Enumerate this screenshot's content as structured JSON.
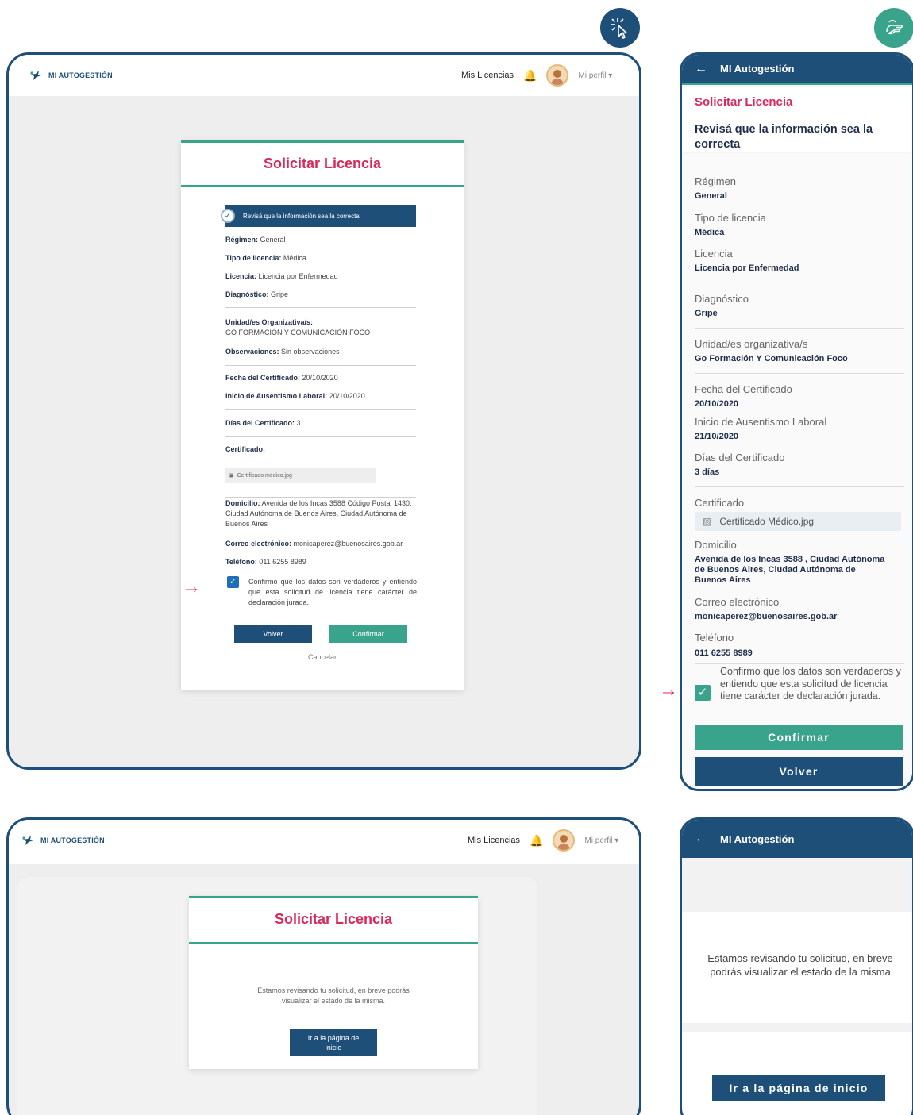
{
  "brand": "MI AUTOGESTIÓN",
  "mobile_app_title": "MI Autogestión",
  "nav": {
    "licencias_a": "Mis Licencias",
    "licencias_b": "Mis Licencias",
    "profile": "Mi perfil"
  },
  "form": {
    "title": "Solicitar Licencia",
    "banner": "Revisá que la información sea la correcta",
    "regimen_label": "Régimen:",
    "regimen_value": "General",
    "tipo_label": "Tipo de licencia:",
    "tipo_value": "Médica",
    "licencia_label": "Licencia:",
    "licencia_value": "Licencia por Enfermedad",
    "diag_label": "Diagnóstico:",
    "diag_value": "Gripe",
    "unidad_label": "Unidad/es Organizativa/s:",
    "unidad_value": "GO FORMACIÓN Y COMUNICACIÓN FOCO",
    "obs_label": "Observaciones:",
    "obs_value": "Sin observaciones",
    "fecha_label": "Fecha del Certificado:",
    "fecha_value": "20/10/2020",
    "inicio_label": "Inicio de Ausentismo Laboral:",
    "inicio_value": "20/10/2020",
    "dias_label": "Días del Certificado:",
    "dias_value": "3",
    "cert_label": "Certificado:",
    "cert_file": "Certificado médico.jpg",
    "dom_label": "Domicilio:",
    "dom_value": "Avenida de los Incas 3588 Código Postal 1430. Ciudad Autónoma de Buenos Aires, Ciudad Autónoma de Buenos Aires",
    "mail_label": "Correo electrónico:",
    "mail_value": "monicaperez@buenosaires.gob.ar",
    "tel_label": "Teléfono:",
    "tel_value": "011 6255 8989",
    "confirm_text": "Confirmo que los datos son verdaderos y entiendo que esta solicitud de licencia tiene carácter de declaración jurada.",
    "volver": "Volver",
    "confirmar": "Confirmar",
    "cancelar": "Cancelar"
  },
  "mobile_form": {
    "title": "Solicitar Licencia",
    "subtitle": "Revisá que la información sea la correcta",
    "regimen_label": "Régimen",
    "regimen_value": "General",
    "tipo_label": "Tipo de licencia",
    "tipo_value": "Médica",
    "licencia_label": "Licencia",
    "licencia_value": "Licencia por Enfermedad",
    "diag_label": "Diagnóstico",
    "diag_value": "Gripe",
    "unidad_label": "Unidad/es organizativa/s",
    "unidad_value": "Go Formación Y Comunicación Foco",
    "fecha_label": "Fecha del Certificado",
    "fecha_value": "20/10/2020",
    "inicio_label": "Inicio de Ausentismo Laboral",
    "inicio_value": "21/10/2020",
    "dias_label": "Días del Certificado",
    "dias_value": "3 días",
    "cert_label": "Certificado",
    "cert_file": "Certificado Médico.jpg",
    "dom_label": "Domicilio",
    "dom_value": "Avenida de los Incas 3588 , Ciudad Autónoma de Buenos Aires, Ciudad Autónoma de Buenos Aires",
    "mail_label": "Correo electrónico",
    "mail_value": "monicaperez@buenosaires.gob.ar",
    "tel_label": "Teléfono",
    "tel_value": "011 6255 8989",
    "confirm_text": "Confirmo que los datos son verdaderos y entiendo que esta solicitud de licencia tiene carácter de declaración jurada.",
    "confirmar": "Confirmar",
    "volver": "Volver"
  },
  "success": {
    "title": "Solicitar Licencia",
    "message": "Estamos revisando tu solicitud, en breve podrás visualizar el estado de la misma.",
    "button": "Ir a la página de inicio",
    "mobile_message": "Estamos revisando tu solicitud, en breve podrás visualizar el estado de la misma",
    "mobile_button": "Ir a la página de inicio"
  },
  "colors": {
    "navy": "#1e4f79",
    "teal": "#3aa38b",
    "crimson": "#d9285a"
  },
  "icons": [
    "cursor-click-icon",
    "touch-hand-icon",
    "bell-icon",
    "back-arrow-icon",
    "check-icon",
    "image-file-icon",
    "arrow-right-icon",
    "brand-bird-icon"
  ]
}
